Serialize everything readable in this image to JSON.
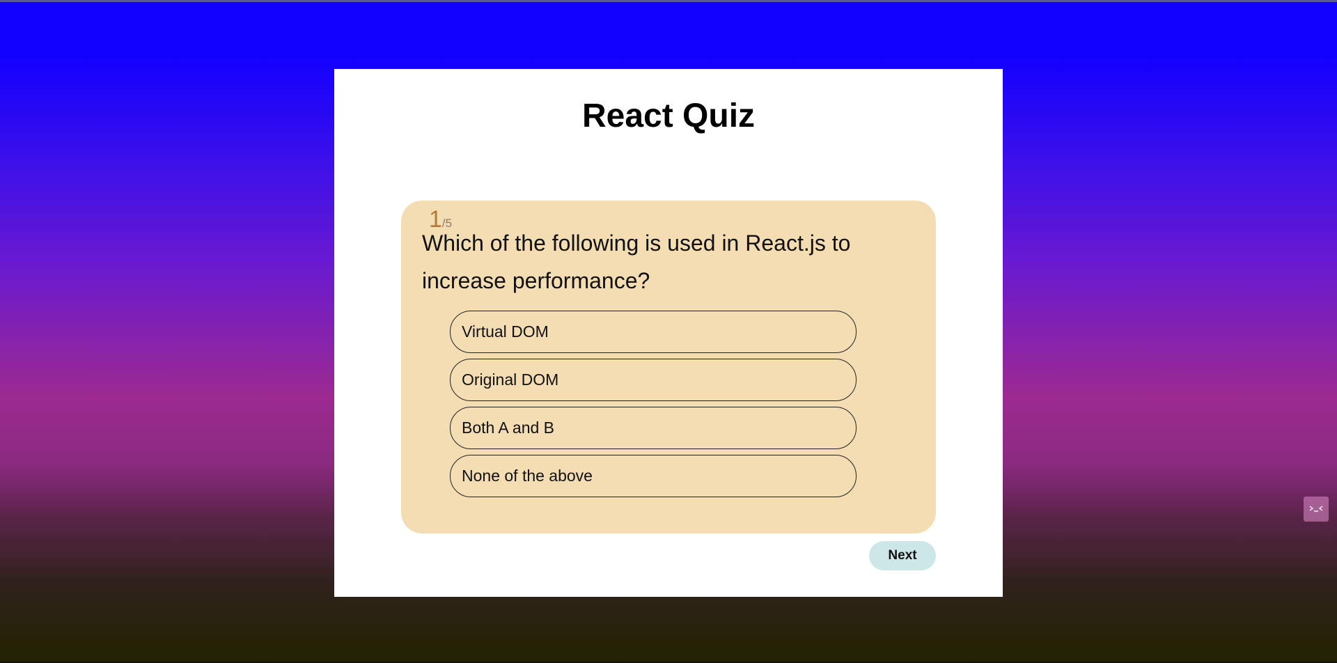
{
  "quiz": {
    "title": "React Quiz",
    "counter": {
      "current": "1",
      "total": "/5"
    },
    "question": "Which of the following is used in React.js to increase performance?",
    "answers": [
      {
        "label": "Virtual DOM"
      },
      {
        "label": "Original DOM"
      },
      {
        "label": "Both A and B"
      },
      {
        "label": "None of the above"
      }
    ],
    "next_label": "Next"
  },
  "colors": {
    "background_top": "#1100ff",
    "background_mid": "#9c2a90",
    "background_bottom": "#222200",
    "panel": "#ffffff",
    "card": "#f4ddb3",
    "counter": "#b07a3a",
    "next_button": "#cde6e7"
  },
  "icons": {
    "helper_widget": "squinting-face-icon"
  }
}
